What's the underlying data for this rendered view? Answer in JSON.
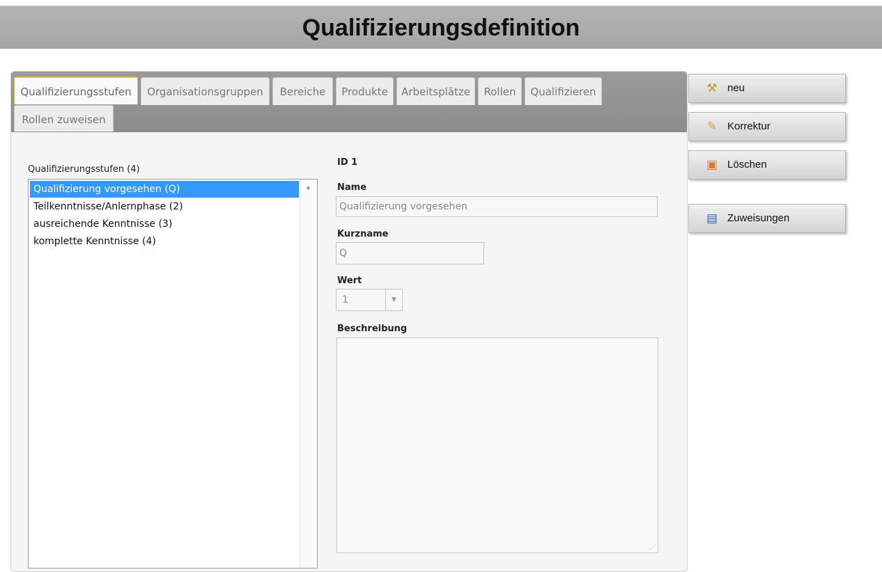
{
  "title": "Qualifizierungsdefinition",
  "tabs": [
    {
      "label": "Qualifizierungsstufen",
      "active": true
    },
    {
      "label": "Organisationsgruppen"
    },
    {
      "label": "Bereiche"
    },
    {
      "label": "Produkte"
    },
    {
      "label": "Arbeitsplätze"
    },
    {
      "label": "Rollen"
    },
    {
      "label": "Qualifizieren"
    },
    {
      "label": "Rollen zuweisen"
    }
  ],
  "list": {
    "label": "Qualifizierungsstufen (4)",
    "items": [
      {
        "label": "Qualifizierung vorgesehen (Q)",
        "selected": true
      },
      {
        "label": "Teilkenntnisse/Anlernphase (2)"
      },
      {
        "label": "ausreichende Kenntnisse (3)"
      },
      {
        "label": "komplette Kenntnisse (4)"
      }
    ]
  },
  "form": {
    "id_label": "ID 1",
    "name_label": "Name",
    "name_value": "Qualifizierung vorgesehen",
    "kurzname_label": "Kurzname",
    "kurzname_value": "Q",
    "wert_label": "Wert",
    "wert_value": "1",
    "beschreibung_label": "Beschreibung",
    "beschreibung_value": ""
  },
  "actions": {
    "neu": {
      "label": "neu",
      "icon": "magic-wand-icon"
    },
    "korrektur": {
      "label": "Korrektur",
      "icon": "pencil-icon"
    },
    "loeschen": {
      "label": "Löschen",
      "icon": "trash-icon"
    },
    "zuweisungen": {
      "label": "Zuweisungen",
      "icon": "book-icon"
    }
  },
  "colors": {
    "selection": "#3399ff",
    "active_tab_border": "#e8c33d",
    "titlebar": "#a9a9a9"
  }
}
